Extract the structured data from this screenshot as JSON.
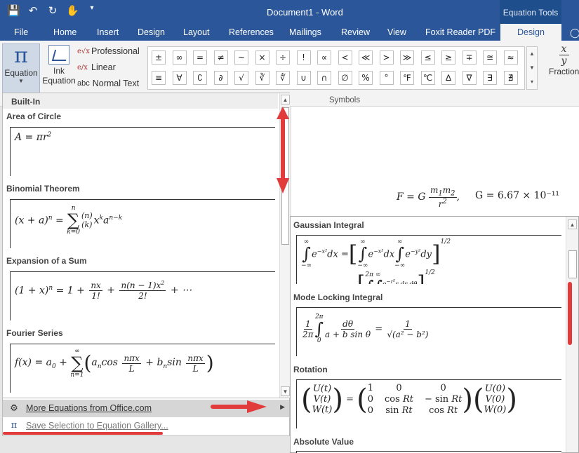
{
  "titlebar": {
    "doc_title": "Document1 - Word",
    "context_title": "Equation Tools",
    "qat_icons": [
      "save-icon",
      "undo-icon",
      "redo-icon",
      "touch-mode-icon",
      "customize-qat-icon"
    ]
  },
  "tabs": [
    "File",
    "Home",
    "Insert",
    "Design",
    "Layout",
    "References",
    "Mailings",
    "Review",
    "View",
    "Foxit Reader PDF"
  ],
  "active_tab": "Design",
  "ribbon": {
    "equation": {
      "glyph": "π",
      "label": "Equation"
    },
    "ink": {
      "line1": "Ink",
      "line2": "Equation"
    },
    "formats": [
      {
        "glyph": "e√x",
        "label": "Professional"
      },
      {
        "glyph": "e/x",
        "label": "Linear"
      },
      {
        "glyph": "abc",
        "label": "Normal Text"
      }
    ],
    "symbols_row1": [
      "±",
      "∞",
      "=",
      "≠",
      "~",
      "×",
      "÷",
      "!",
      "∝",
      "<",
      "≪",
      ">",
      "≫",
      "≤",
      "≥",
      "∓",
      "≅",
      "≈"
    ],
    "symbols_row2": [
      "≡",
      "∀",
      "∁",
      "∂",
      "√",
      "∛",
      "∜",
      "∪",
      "∩",
      "∅",
      "%",
      "°",
      "℉",
      "℃",
      "∆",
      "∇",
      "∃",
      "∄"
    ],
    "symbols_label": "Symbols",
    "fraction": {
      "top": "x",
      "bottom": "y",
      "label": "Fraction"
    }
  },
  "gallery": {
    "header": "Built-In",
    "items": [
      {
        "title": "Area of Circle"
      },
      {
        "title": "Binomial Theorem"
      },
      {
        "title": "Expansion of a Sum"
      },
      {
        "title": "Fourier Series"
      }
    ]
  },
  "menu": {
    "more": "More Equations from Office.com",
    "save": "Save Selection to Equation Gallery..."
  },
  "gallery2": {
    "items": [
      {
        "title": "Gaussian Integral"
      },
      {
        "title": "Mode Locking Integral"
      },
      {
        "title": "Rotation"
      },
      {
        "title": "Absolute Value"
      }
    ]
  },
  "document": {
    "gravity_const": "G = 6.67 × 10⁻¹¹"
  }
}
